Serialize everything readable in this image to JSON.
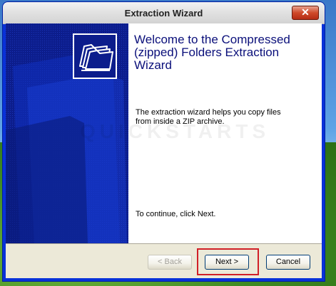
{
  "window": {
    "title": "Extraction Wizard",
    "close_label": "✕"
  },
  "content": {
    "heading": "Welcome to the Compressed (zipped) Folders Extraction Wizard",
    "description": "The extraction wizard helps you copy files from inside a ZIP archive.",
    "continue_text": "To continue, click Next.",
    "watermark": "QUICKSTARTS"
  },
  "buttons": {
    "back": "< Back",
    "next": "Next >",
    "cancel": "Cancel"
  },
  "icons": {
    "side": "folder-files-icon"
  },
  "colors": {
    "side_panel": "#0c1d8c",
    "heading": "#0a0f7a",
    "highlight": "#d11f27"
  }
}
